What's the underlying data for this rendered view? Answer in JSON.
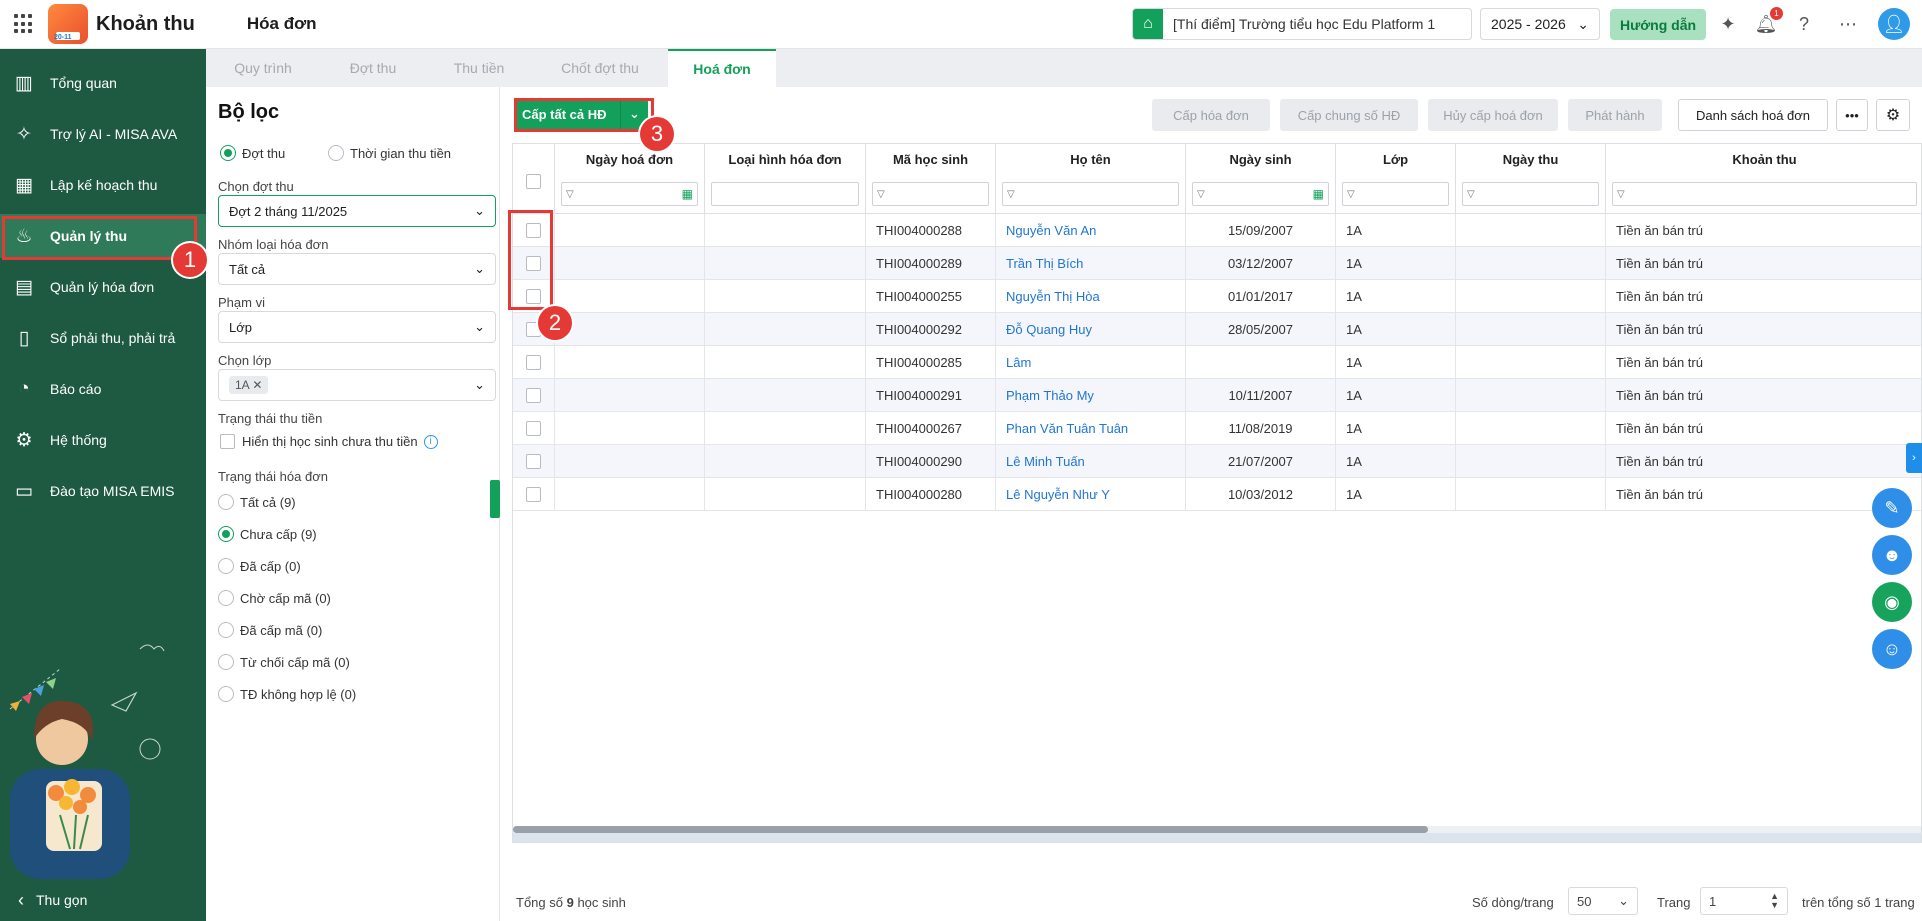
{
  "topbar": {
    "app_name": "Khoản thu",
    "logo_badge": "20-11",
    "page_title": "Hóa đơn",
    "school": "[Thí điểm] Trường tiểu học Edu Platform 1",
    "year": "2025 - 2026",
    "guide_label": "Hướng dẫn",
    "notification_count": "1",
    "icons": [
      "apps-icon",
      "ai-sparkle-icon",
      "bell-icon",
      "help-icon",
      "more-icon",
      "user-avatar-icon"
    ]
  },
  "sidebar": {
    "items": [
      {
        "label": "Tổng quan",
        "icon": "chart-bars-icon"
      },
      {
        "label": "Trợ lý AI - MISA AVA",
        "icon": "ai-sparkle-icon"
      },
      {
        "label": "Lập kế hoạch thu",
        "icon": "calendar-money-icon"
      },
      {
        "label": "Quản lý thu",
        "icon": "hand-coin-icon",
        "active": true
      },
      {
        "label": "Quản lý hóa đơn",
        "icon": "invoice-icon"
      },
      {
        "label": "Sổ phải thu, phải trả",
        "icon": "ledger-icon"
      },
      {
        "label": "Báo cáo",
        "icon": "pie-chart-icon"
      },
      {
        "label": "Hệ thống",
        "icon": "gear-icon"
      },
      {
        "label": "Đào tạo MISA EMIS",
        "icon": "book-icon"
      }
    ],
    "collapse_label": "Thu gọn"
  },
  "tabs": [
    {
      "label": "Quy trình",
      "active": false
    },
    {
      "label": "Đợt thu",
      "active": false
    },
    {
      "label": "Thu tiền",
      "active": false
    },
    {
      "label": "Chốt đợt thu",
      "active": false
    },
    {
      "label": "Hoá đơn",
      "active": true
    }
  ],
  "filter": {
    "title": "Bộ lọc",
    "mode_options": [
      "Đợt thu",
      "Thời gian thu tiền"
    ],
    "mode_selected": "Đợt thu",
    "period_label": "Chọn đợt thu",
    "period_value": "Đợt 2 tháng 11/2025",
    "group_label": "Nhóm loại hóa đơn",
    "group_value": "Tất cả",
    "scope_label": "Phạm vi",
    "scope_value": "Lớp",
    "class_label": "Chọn lớp",
    "class_chip": "1A",
    "payment_status_label": "Trạng thái thu tiền",
    "show_unpaid_label": "Hiển thị học sinh chưa thu tiền",
    "invoice_status_label": "Trạng thái hóa đơn",
    "invoice_status_options": [
      {
        "label": "Tất cả (9)",
        "on": false
      },
      {
        "label": "Chưa cấp (9)",
        "on": true
      },
      {
        "label": "Đã cấp (0)",
        "on": false
      },
      {
        "label": "Chờ cấp mã (0)",
        "on": false
      },
      {
        "label": "Đã cấp mã (0)",
        "on": false
      },
      {
        "label": "Từ chối cấp mã (0)",
        "on": false
      },
      {
        "label": "TĐ không hợp lệ (0)",
        "on": false
      }
    ]
  },
  "toolbar": {
    "issue_all_label": "Cấp tất cả HĐ",
    "issue_invoice_label": "Cấp hóa đơn",
    "issue_shared_label": "Cấp chung số HĐ",
    "cancel_issue_label": "Hủy cấp hoá đơn",
    "publish_label": "Phát hành",
    "invoice_list_label": "Danh sách hoá đơn",
    "more_label": "•••"
  },
  "table": {
    "columns": [
      "Ngày hoá đơn",
      "Loại hình hóa đơn",
      "Mã học sinh",
      "Họ tên",
      "Ngày sinh",
      "Lớp",
      "Ngày thu",
      "Khoản thu"
    ],
    "rows": [
      {
        "code": "THI004000288",
        "name": "Nguyễn Văn An",
        "dob": "15/09/2007",
        "class": "1A",
        "fee": "Tiền ăn bán trú"
      },
      {
        "code": "THI004000289",
        "name": "Trần Thị Bích",
        "dob": "03/12/2007",
        "class": "1A",
        "fee": "Tiền ăn bán trú"
      },
      {
        "code": "THI004000255",
        "name": "Nguyễn Thị Hòa",
        "dob": "01/01/2017",
        "class": "1A",
        "fee": "Tiền ăn bán trú"
      },
      {
        "code": "THI004000292",
        "name": "Đỗ Quang Huy",
        "dob": "28/05/2007",
        "class": "1A",
        "fee": "Tiền ăn bán trú"
      },
      {
        "code": "THI004000285",
        "name": "Lâm",
        "dob": "",
        "class": "1A",
        "fee": "Tiền ăn bán trú"
      },
      {
        "code": "THI004000291",
        "name": "Phạm Thảo My",
        "dob": "10/11/2007",
        "class": "1A",
        "fee": "Tiền ăn bán trú"
      },
      {
        "code": "THI004000267",
        "name": "Phan Văn Tuân Tuân",
        "dob": "11/08/2019",
        "class": "1A",
        "fee": "Tiền ăn bán trú"
      },
      {
        "code": "THI004000290",
        "name": "Lê Minh Tuấn",
        "dob": "21/07/2007",
        "class": "1A",
        "fee": "Tiền ăn bán trú"
      },
      {
        "code": "THI004000280",
        "name": "Lê Nguyễn Như Y",
        "dob": "10/03/2012",
        "class": "1A",
        "fee": "Tiền ăn bán trú"
      }
    ]
  },
  "footer": {
    "total_prefix": "Tổng số ",
    "total_count": "9",
    "total_suffix": " học sinh",
    "rows_per_page_label": "Số dòng/trang",
    "rows_per_page": "50",
    "page_label": "Trang",
    "page": "1",
    "total_pages_text": "trên tổng số 1 trang"
  },
  "annotations": [
    "1",
    "2",
    "3"
  ],
  "colors": {
    "brand_green": "#12a05b",
    "sidebar_bg": "#1e5a41",
    "link_blue": "#2176d2",
    "annotation_red": "#e53935"
  }
}
